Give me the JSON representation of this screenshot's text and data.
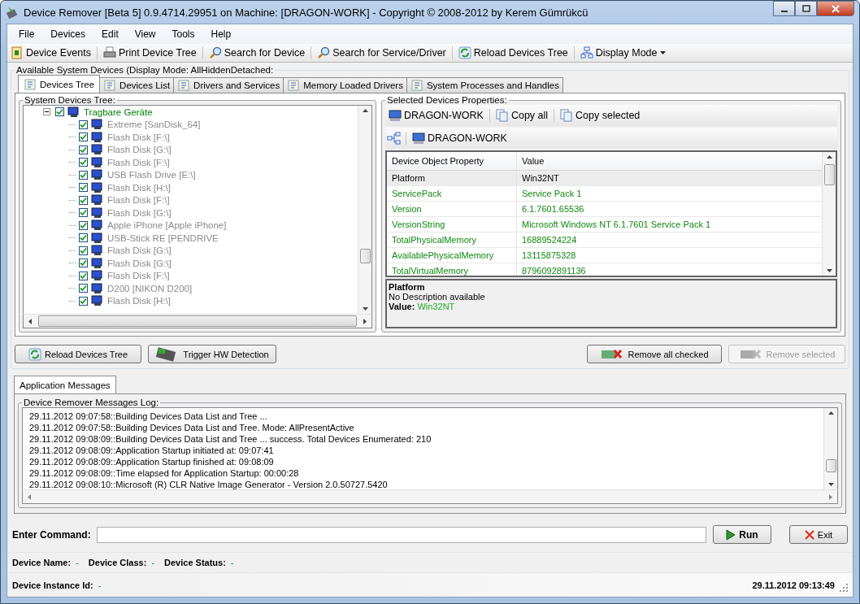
{
  "window": {
    "title": "Device Remover [Beta 5] 0.9.4714.29951 on Machine: [DRAGON-WORK] - Copyright © 2008-2012 by Kerem Gümrükcü"
  },
  "menu": [
    "File",
    "Devices",
    "Edit",
    "View",
    "Tools",
    "Help"
  ],
  "toolbar": [
    {
      "label": "Device Events",
      "kind": "button"
    },
    {
      "label": "Print Device Tree",
      "kind": "button"
    },
    {
      "label": "Search for Device",
      "kind": "button"
    },
    {
      "label": "Search for Service/Driver",
      "kind": "button"
    },
    {
      "label": "Reload Devices Tree",
      "kind": "button"
    },
    {
      "label": "Display Mode",
      "kind": "dropdown"
    }
  ],
  "devices_group": {
    "label": "Available System Devices (Display Mode: AllHiddenDetached:"
  },
  "tabs": [
    {
      "label": "Devices Tree",
      "selected": true
    },
    {
      "label": "Devices List",
      "selected": false
    },
    {
      "label": "Drivers and Services",
      "selected": false
    },
    {
      "label": "Memory Loaded Drivers",
      "selected": false
    },
    {
      "label": "System Processes and Handles",
      "selected": false
    }
  ],
  "tree": {
    "label": "System Devices Tree:",
    "root": {
      "label": "Tragbare Geräte",
      "checked": true,
      "expanded": true,
      "children": [
        {
          "label": "Extreme [SanDisk_64]",
          "checked": true
        },
        {
          "label": "Flash Disk [F:\\]",
          "checked": true
        },
        {
          "label": "Flash Disk [G:\\]",
          "checked": true
        },
        {
          "label": "Flash Disk [F:\\]",
          "checked": true
        },
        {
          "label": "USB Flash Drive [E:\\]",
          "checked": true
        },
        {
          "label": "Flash Disk [H:\\]",
          "checked": true
        },
        {
          "label": "Flash Disk [F:\\]",
          "checked": true
        },
        {
          "label": "Flash Disk [G:\\]",
          "checked": true
        },
        {
          "label": "Apple iPhone [Apple iPhone]",
          "checked": true
        },
        {
          "label": "USB-Stick  RE [PENDRIVE",
          "checked": true
        },
        {
          "label": "Flash Disk [G:\\]",
          "checked": true
        },
        {
          "label": "Flash Disk [G:\\]",
          "checked": true
        },
        {
          "label": "Flash Disk [F:\\]",
          "checked": true
        },
        {
          "label": "D200 [NIKON D200]",
          "checked": true
        },
        {
          "label": "Flash Disk [H:\\]",
          "checked": true
        }
      ]
    }
  },
  "properties": {
    "label": "Selected Devices Properties:",
    "machine": "DRAGON-WORK",
    "copy_all": "Copy all",
    "copy_selected": "Copy selected",
    "path_machine": "DRAGON-WORK",
    "columns": [
      "Device Object Property",
      "Value"
    ],
    "rows": [
      {
        "property": "Platform",
        "value": "Win32NT",
        "selected": true
      },
      {
        "property": "ServicePack",
        "value": "Service Pack 1",
        "selected": false
      },
      {
        "property": "Version",
        "value": "6.1.7601.65536",
        "selected": false
      },
      {
        "property": "VersionString",
        "value": "Microsoft Windows NT 6.1.7601 Service Pack 1",
        "selected": false
      },
      {
        "property": "TotalPhysicalMemory",
        "value": "16889524224",
        "selected": false
      },
      {
        "property": "AvailablePhysicalMemory",
        "value": "13115875328",
        "selected": false
      },
      {
        "property": "TotalVirtualMemory",
        "value": "8796092891136",
        "selected": false
      }
    ],
    "description": {
      "title": "Platform",
      "text": "No Description available",
      "value_label": "Value:",
      "value": "Win32NT"
    }
  },
  "actions": [
    {
      "label": "Reload Devices Tree",
      "disabled": false
    },
    {
      "label": "Trigger HW Detection",
      "disabled": false
    },
    {
      "label": "Remove all checked",
      "disabled": false
    },
    {
      "label": "Remove selected",
      "disabled": true
    }
  ],
  "messages": {
    "tab": "Application Messages",
    "label": "Device Remover Messages Log:",
    "lines": [
      "29.11.2012 09:07:58::Building Devices Data List and Tree ...",
      "29.11.2012 09:07:58::Building Devices Data List and Tree. Mode: AllPresentActive",
      "29.11.2012 09:08:09::Building Devices Data List and Tree ... success. Total Devices Enumerated: 210",
      "29.11.2012 09:08:09::Application Startup initiated at: 09:07:41",
      "29.11.2012 09:08:09::Application Startup finished at: 09:08:09",
      "29.11.2012 09:08:09::Time elapsed for Application Startup: 00:00:28",
      "29.11.2012 09:08:10::Microsoft (R) CLR Native Image Generator - Version 2.0.50727.5420"
    ]
  },
  "command": {
    "label": "Enter Command:",
    "run": "Run",
    "exit": "Exit"
  },
  "status": {
    "fields": [
      {
        "label": "Device Name:",
        "value": "-"
      },
      {
        "label": "Device Class:",
        "value": "-"
      },
      {
        "label": "Device Status:",
        "value": "-"
      }
    ],
    "instance": {
      "label": "Device Instance Id:",
      "value": "-"
    },
    "time": "29.11.2012 09:13:49"
  }
}
